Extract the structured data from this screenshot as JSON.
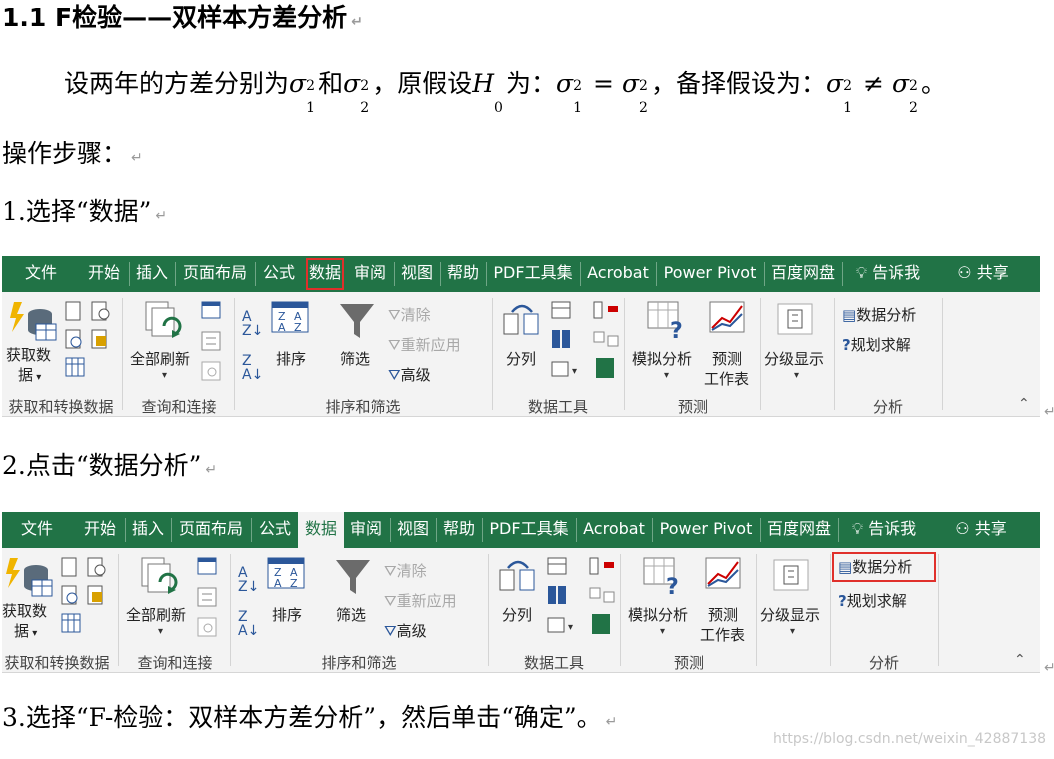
{
  "heading": "1.1 F检验——双样本方差分析",
  "intro": {
    "text1": "设两年的方差分别为",
    "and": "和",
    "text2": "，原假设",
    "text3": "为：",
    "text4": "，备择假设为：",
    "end": "。"
  },
  "steps_title": "操作步骤：",
  "step1": "1.选择“数据”",
  "step2": "2.点击“数据分析”",
  "step3": "3.选择“F-检验：双样本方差分析”，然后单击“确定”。",
  "paragraph_mark": "↵",
  "ribbon": {
    "tabs": [
      "文件",
      "开始",
      "插入",
      "页面布局",
      "公式",
      "数据",
      "审阅",
      "视图",
      "帮助",
      "PDF工具集",
      "Acrobat",
      "Power Pivot",
      "百度网盘",
      "告诉我",
      "共享"
    ],
    "groups": [
      "获取和转换数据",
      "查询和连接",
      "排序和筛选",
      "数据工具",
      "预测",
      "分析"
    ],
    "get_data": "获取数",
    "get_data2": "据",
    "refresh_all": "全部刷新",
    "sort": "排序",
    "filter": "筛选",
    "clear": "清除",
    "reapply": "重新应用",
    "advanced": "高级",
    "text_to_columns": "分列",
    "what_if": "模拟分析",
    "forecast_sheet1": "预测",
    "forecast_sheet2": "工作表",
    "outline": "分级显示",
    "data_analysis": "数据分析",
    "solver": "规划求解"
  },
  "watermark": "https://blog.csdn.net/weixin_42887138",
  "colors": {
    "ribbon_green": "#217346",
    "highlight_red": "#e0302b"
  }
}
